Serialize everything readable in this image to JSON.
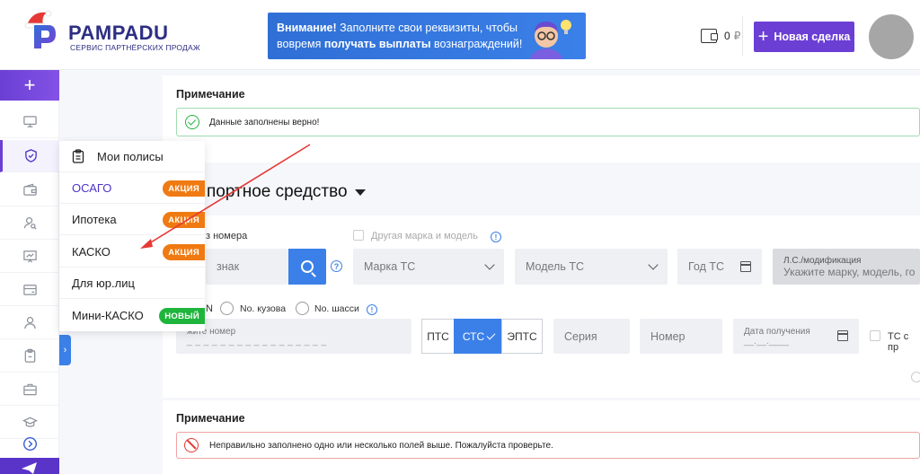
{
  "brand": {
    "name": "PAMPADU",
    "tagline": "СЕРВИС ПАРТНЁРСКИХ ПРОДАЖ"
  },
  "banner": {
    "lead": "Внимание!",
    "text1": " Заполните свои реквизиты, чтобы",
    "text2a": "вовремя ",
    "text2b": "получать выплаты",
    "text2c": " вознаграждений!"
  },
  "wallet": {
    "amount": "0",
    "currency": "₽"
  },
  "header": {
    "new_deal_label": "Новая сделка"
  },
  "menu": {
    "items": [
      {
        "label": "Мои полисы",
        "badge": ""
      },
      {
        "label": "ОСАГО",
        "badge": "АКЦИЯ"
      },
      {
        "label": "Ипотека",
        "badge": "АКЦИЯ"
      },
      {
        "label": "КАСКО",
        "badge": "АКЦИЯ"
      },
      {
        "label": "Для юр.лиц",
        "badge": ""
      },
      {
        "label": "Мини-КАСКО",
        "badge": "НОВЫЙ"
      }
    ]
  },
  "notes": {
    "label": "Примечание",
    "ok_text": "Данные заполнены верно!",
    "err_text": "Неправильно заполнено одно или несколько полей выше. Пожалуйста проверьте."
  },
  "vehicle": {
    "title": "портное средство",
    "no_plate_label": "з номера",
    "other_model_label": "Другая марка и модель",
    "plate_placeholder": "знак",
    "brand_placeholder": "Марка ТС",
    "model_placeholder": "Модель ТС",
    "year_placeholder": "Год ТС",
    "modification_label": "Л.С./модификация",
    "modification_placeholder": "Укажите марку, модель, го",
    "id_type_vin": "N",
    "id_type_body": "No. кузова",
    "id_type_chassis": "No. шасси",
    "number_placeholder": "жите номер",
    "number_mask": "_ _ _ _ _ _ _ _ _ _ _ _ _ _ _ _ _",
    "doc_types": [
      "ПТС",
      "СТС",
      "ЭПТС"
    ],
    "series_placeholder": "Серия",
    "doc_number_placeholder": "Номер",
    "date_label": "Дата получения",
    "date_mask": "__.__.____",
    "ts_checkbox_label": "ТС с пр"
  },
  "colors": {
    "accent": "#6b3fd4",
    "blue": "#3b80e8",
    "promo": "#f07a12",
    "new": "#1fb53c",
    "error": "#e53935"
  }
}
